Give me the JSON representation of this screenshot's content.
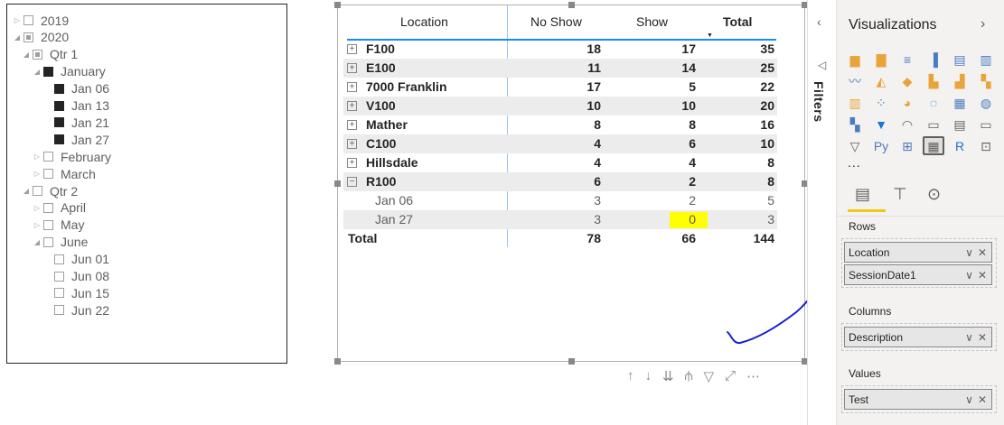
{
  "slicer": {
    "items": [
      {
        "label": "2019",
        "level": 0,
        "expand": "▷",
        "state": "empty"
      },
      {
        "label": "2020",
        "level": 0,
        "expand": "◢",
        "state": "partial"
      },
      {
        "label": "Qtr 1",
        "level": 1,
        "expand": "◢",
        "state": "partial"
      },
      {
        "label": "January",
        "level": 2,
        "expand": "◢",
        "state": "checked"
      },
      {
        "label": "Jan 06",
        "level": 3,
        "expand": "",
        "state": "checked"
      },
      {
        "label": "Jan 13",
        "level": 3,
        "expand": "",
        "state": "checked"
      },
      {
        "label": "Jan 21",
        "level": 3,
        "expand": "",
        "state": "checked"
      },
      {
        "label": "Jan 27",
        "level": 3,
        "expand": "",
        "state": "checked"
      },
      {
        "label": "February",
        "level": 2,
        "expand": "▷",
        "state": "empty"
      },
      {
        "label": "March",
        "level": 2,
        "expand": "▷",
        "state": "empty"
      },
      {
        "label": "Qtr 2",
        "level": 1,
        "expand": "◢",
        "state": "empty"
      },
      {
        "label": "April",
        "level": 2,
        "expand": "▷",
        "state": "empty"
      },
      {
        "label": "May",
        "level": 2,
        "expand": "▷",
        "state": "empty"
      },
      {
        "label": "June",
        "level": 2,
        "expand": "◢",
        "state": "empty"
      },
      {
        "label": "Jun 01",
        "level": 3,
        "expand": "",
        "state": "empty"
      },
      {
        "label": "Jun 08",
        "level": 3,
        "expand": "",
        "state": "empty"
      },
      {
        "label": "Jun 15",
        "level": 3,
        "expand": "",
        "state": "empty"
      },
      {
        "label": "Jun 22",
        "level": 3,
        "expand": "",
        "state": "empty"
      }
    ]
  },
  "table": {
    "headers": {
      "location": "Location",
      "noshow": "No Show",
      "show": "Show",
      "total": "Total"
    },
    "rows": [
      {
        "label": "F100",
        "noshow": "18",
        "show": "17",
        "total": "35",
        "type": "group",
        "toggle": "+"
      },
      {
        "label": "E100",
        "noshow": "11",
        "show": "14",
        "total": "25",
        "type": "group",
        "toggle": "+"
      },
      {
        "label": "7000 Franklin",
        "noshow": "17",
        "show": "5",
        "total": "22",
        "type": "group",
        "toggle": "+"
      },
      {
        "label": "V100",
        "noshow": "10",
        "show": "10",
        "total": "20",
        "type": "group",
        "toggle": "+"
      },
      {
        "label": "Mather",
        "noshow": "8",
        "show": "8",
        "total": "16",
        "type": "group",
        "toggle": "+"
      },
      {
        "label": "C100",
        "noshow": "4",
        "show": "6",
        "total": "10",
        "type": "group",
        "toggle": "+"
      },
      {
        "label": "Hillsdale",
        "noshow": "4",
        "show": "4",
        "total": "8",
        "type": "group",
        "toggle": "+"
      },
      {
        "label": "R100",
        "noshow": "6",
        "show": "2",
        "total": "8",
        "type": "group",
        "toggle": "−"
      },
      {
        "label": "Jan 06",
        "noshow": "3",
        "show": "2",
        "total": "5",
        "type": "sub",
        "toggle": ""
      },
      {
        "label": "Jan 27",
        "noshow": "3",
        "show": "0",
        "total": "3",
        "type": "sub",
        "toggle": "",
        "highlight": true
      },
      {
        "label": "Total",
        "noshow": "78",
        "show": "66",
        "total": "144",
        "type": "total",
        "toggle": ""
      }
    ]
  },
  "vis_toolbar": {
    "icons": [
      "↑",
      "↓",
      "⇊",
      "⫛",
      "▽",
      "⤢",
      "⋯"
    ]
  },
  "filters": {
    "label": "Filters",
    "collapse": "‹",
    "icon": "◁"
  },
  "viz": {
    "title": "Visualizations",
    "collapse": "›",
    "more": "...",
    "icons": [
      {
        "g": "▆",
        "c": "#e8a33a"
      },
      {
        "g": "▇",
        "c": "#e8a33a"
      },
      {
        "g": "≡",
        "c": "#4a7bbf"
      },
      {
        "g": "▐",
        "c": "#4a7bbf"
      },
      {
        "g": "▤",
        "c": "#4a7bbf"
      },
      {
        "g": "▥",
        "c": "#4a7bbf"
      },
      {
        "g": "〰",
        "c": "#4a7bbf"
      },
      {
        "g": "◭",
        "c": "#e8a33a"
      },
      {
        "g": "◆",
        "c": "#e8a33a"
      },
      {
        "g": "▙",
        "c": "#e8a33a"
      },
      {
        "g": "▟",
        "c": "#e8a33a"
      },
      {
        "g": "▚",
        "c": "#e8a33a"
      },
      {
        "g": "▥",
        "c": "#e8a33a"
      },
      {
        "g": "⁘",
        "c": "#4a7bbf"
      },
      {
        "g": "◕",
        "c": "#e8a33a"
      },
      {
        "g": "◌",
        "c": "#1a73d6"
      },
      {
        "g": "▦",
        "c": "#4a7bbf"
      },
      {
        "g": "◍",
        "c": "#4a7bbf"
      },
      {
        "g": "▚",
        "c": "#4a7bbf"
      },
      {
        "g": "▼",
        "c": "#1a73d6"
      },
      {
        "g": "◠",
        "c": "#605e5c"
      },
      {
        "g": "▭",
        "c": "#605e5c"
      },
      {
        "g": "▤",
        "c": "#605e5c"
      },
      {
        "g": "▭",
        "c": "#605e5c"
      },
      {
        "g": "▽",
        "c": "#605e5c"
      },
      {
        "g": "Py",
        "c": "#4a7bbf"
      },
      {
        "g": "⊞",
        "c": "#4a7bbf"
      },
      {
        "g": "▦",
        "c": "#605e5c"
      },
      {
        "g": "R",
        "c": "#1a73d6"
      },
      {
        "g": "⊡",
        "c": "#605e5c"
      }
    ],
    "tabs": [
      "▤",
      "⊤",
      "⊙"
    ],
    "rows_label": "Rows",
    "rows": [
      "Location",
      "SessionDate1"
    ],
    "columns_label": "Columns",
    "columns": [
      "Description"
    ],
    "values_label": "Values",
    "values": [
      "Test"
    ],
    "well_ctl": {
      "chevron": "∨",
      "remove": "✕"
    }
  }
}
